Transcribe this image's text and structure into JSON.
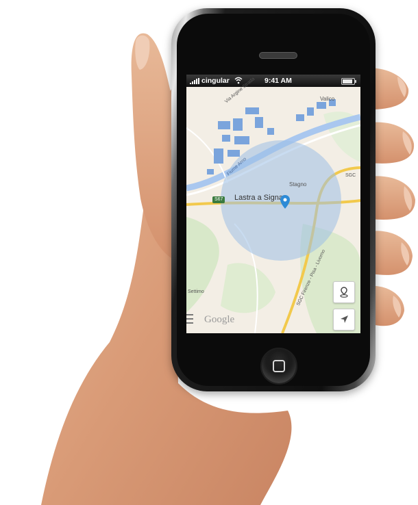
{
  "statusbar": {
    "carrier": "cingular",
    "time": "9:41 AM"
  },
  "map": {
    "labels": {
      "town": "Lastra a Signa",
      "stagno": "Stagno",
      "vaicio": "Valico",
      "via": "Via Argine Strada",
      "river": "Fiume Arno",
      "sgc": "SGC",
      "sgc_road": "SGC Firenze - Pisa - Livorno",
      "settimo": "Settimo"
    },
    "road_shield": "S67",
    "attribution": "Google"
  },
  "colors": {
    "accent": "#2e8bd6",
    "water": "#a9c7ef",
    "road": "#f2c94c",
    "radius_fill": "#9dc0e6"
  },
  "icons": {
    "signal": "signal-bars-icon",
    "wifi": "wifi-icon",
    "battery": "battery-icon",
    "pin": "map-pin-icon",
    "locate": "navigation-arrow-icon",
    "menu": "menu-icon",
    "home": "home-button-icon"
  }
}
